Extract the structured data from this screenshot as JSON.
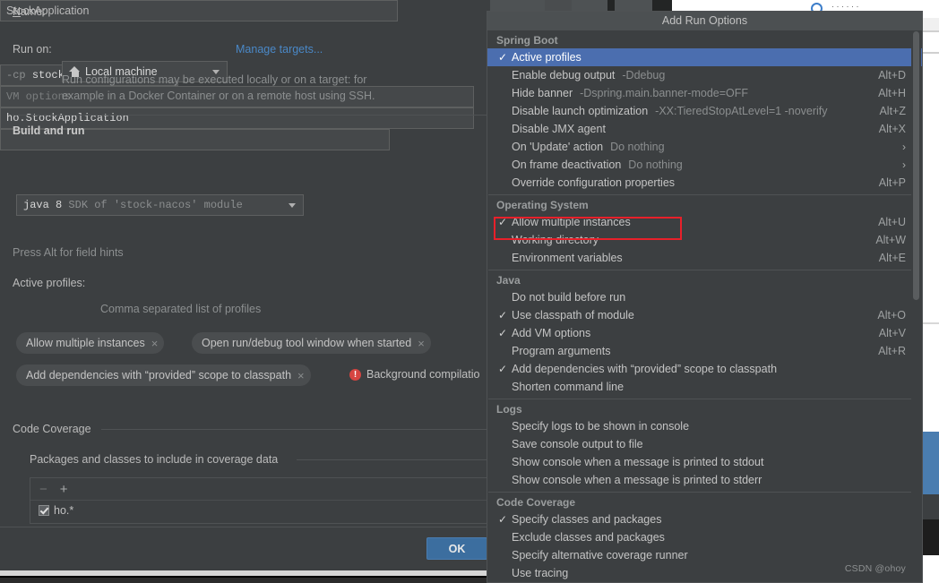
{
  "dialog": {
    "name_label": "Name:",
    "name_value": "StockApplication",
    "run_on_label": "Run on:",
    "run_on_value": "Local machine",
    "manage_targets_link": "Manage targets...",
    "run_on_hint_line1": "Run configurations may be executed locally or on a target: for",
    "run_on_hint_line2": "example in a Docker Container or on a remote host using SSH.",
    "build_and_run_header": "Build and run",
    "jre_value": "java 8",
    "jre_suffix": "SDK of 'stock-nacos' module",
    "classpath_prefix": "-cp",
    "classpath_value": "stock-nacos",
    "vm_options_placeholder": "VM options",
    "main_class_value": "ho.StockApplication",
    "field_hints": "Press Alt for field hints",
    "active_profiles_label": "Active profiles:",
    "active_profiles_value": "",
    "active_profiles_hint": "Comma separated list of profiles",
    "chips": [
      {
        "label": "Allow multiple instances",
        "close": "×"
      },
      {
        "label": "Open run/debug tool window when started",
        "close": "×"
      },
      {
        "label": "Add dependencies with  “provided”  scope to classpath",
        "close": "×"
      }
    ],
    "warning_icon": "!",
    "warning_text": "Background compilatio",
    "code_coverage_header": "Code Coverage",
    "coverage_group_label": "Packages and classes to include in coverage data",
    "toolbar_remove": "−",
    "toolbar_add": "+",
    "coverage_rows": [
      {
        "checked": true,
        "pattern": "ho.*"
      }
    ],
    "ok_label": "OK"
  },
  "popup": {
    "title": "Add Run Options",
    "scroll_indicator": "scrollbar",
    "groups": [
      {
        "name": "Spring Boot",
        "items": [
          {
            "label": "Active profiles",
            "sub": "",
            "shortcut": "",
            "checked": true,
            "selected": true,
            "submenu": false
          },
          {
            "label": "Enable debug output",
            "sub": "-Ddebug",
            "shortcut": "Alt+D",
            "checked": false,
            "selected": false,
            "submenu": false
          },
          {
            "label": "Hide banner",
            "sub": "-Dspring.main.banner-mode=OFF",
            "shortcut": "Alt+H",
            "checked": false,
            "selected": false,
            "submenu": false
          },
          {
            "label": "Disable launch optimization",
            "sub": "-XX:TieredStopAtLevel=1 -noverify",
            "shortcut": "Alt+Z",
            "checked": false,
            "selected": false,
            "submenu": false
          },
          {
            "label": "Disable JMX agent",
            "sub": "",
            "shortcut": "Alt+X",
            "checked": false,
            "selected": false,
            "submenu": false
          },
          {
            "label": "On 'Update' action",
            "sub": "Do nothing",
            "shortcut": "",
            "checked": false,
            "selected": false,
            "submenu": true
          },
          {
            "label": "On frame deactivation",
            "sub": "Do nothing",
            "shortcut": "",
            "checked": false,
            "selected": false,
            "submenu": true
          },
          {
            "label": "Override configuration properties",
            "sub": "",
            "shortcut": "Alt+P",
            "checked": false,
            "selected": false,
            "submenu": false
          }
        ]
      },
      {
        "name": "Operating System",
        "items": [
          {
            "label": "Allow multiple instances",
            "sub": "",
            "shortcut": "Alt+U",
            "checked": true,
            "selected": false,
            "submenu": false
          },
          {
            "label": "Working directory",
            "sub": "",
            "shortcut": "Alt+W",
            "checked": false,
            "selected": false,
            "submenu": false
          },
          {
            "label": "Environment variables",
            "sub": "",
            "shortcut": "Alt+E",
            "checked": false,
            "selected": false,
            "submenu": false
          }
        ]
      },
      {
        "name": "Java",
        "items": [
          {
            "label": "Do not build before run",
            "sub": "",
            "shortcut": "",
            "checked": false,
            "selected": false,
            "submenu": false
          },
          {
            "label": "Use classpath of module",
            "sub": "",
            "shortcut": "Alt+O",
            "checked": true,
            "selected": false,
            "submenu": false
          },
          {
            "label": "Add VM options",
            "sub": "",
            "shortcut": "Alt+V",
            "checked": true,
            "selected": false,
            "submenu": false
          },
          {
            "label": "Program arguments",
            "sub": "",
            "shortcut": "Alt+R",
            "checked": false,
            "selected": false,
            "submenu": false
          },
          {
            "label": "Add dependencies with  “provided”  scope to classpath",
            "sub": "",
            "shortcut": "",
            "checked": true,
            "selected": false,
            "submenu": false
          },
          {
            "label": "Shorten command line",
            "sub": "",
            "shortcut": "",
            "checked": false,
            "selected": false,
            "submenu": false
          }
        ]
      },
      {
        "name": "Logs",
        "items": [
          {
            "label": "Specify logs to be shown in console",
            "sub": "",
            "shortcut": "",
            "checked": false,
            "selected": false,
            "submenu": false
          },
          {
            "label": "Save console output to file",
            "sub": "",
            "shortcut": "",
            "checked": false,
            "selected": false,
            "submenu": false
          },
          {
            "label": "Show console when a message is printed to stdout",
            "sub": "",
            "shortcut": "",
            "checked": false,
            "selected": false,
            "submenu": false
          },
          {
            "label": "Show console when a message is printed to stderr",
            "sub": "",
            "shortcut": "",
            "checked": false,
            "selected": false,
            "submenu": false
          }
        ]
      },
      {
        "name": "Code Coverage",
        "items": [
          {
            "label": "Specify classes and packages",
            "sub": "",
            "shortcut": "",
            "checked": true,
            "selected": false,
            "submenu": false
          },
          {
            "label": "Exclude classes and packages",
            "sub": "",
            "shortcut": "",
            "checked": false,
            "selected": false,
            "submenu": false
          },
          {
            "label": "Specify alternative coverage runner",
            "sub": "",
            "shortcut": "",
            "checked": false,
            "selected": false,
            "submenu": false
          },
          {
            "label": "Use tracing",
            "sub": "",
            "shortcut": "",
            "checked": false,
            "selected": false,
            "submenu": false
          }
        ]
      }
    ]
  },
  "annotation": {
    "highlight_target": "Allow multiple instances",
    "highlight_color": "#e8202a"
  },
  "watermark": "CSDN @ohoy",
  "colors": {
    "dialog_bg": "#3c3f41",
    "field_bg": "#45484a",
    "selection_blue": "#4b6eaf",
    "link_blue": "#4a88c7",
    "accent_ok": "#3c6e9f",
    "error_red": "#d64541",
    "highlight_red": "#e8202a"
  }
}
